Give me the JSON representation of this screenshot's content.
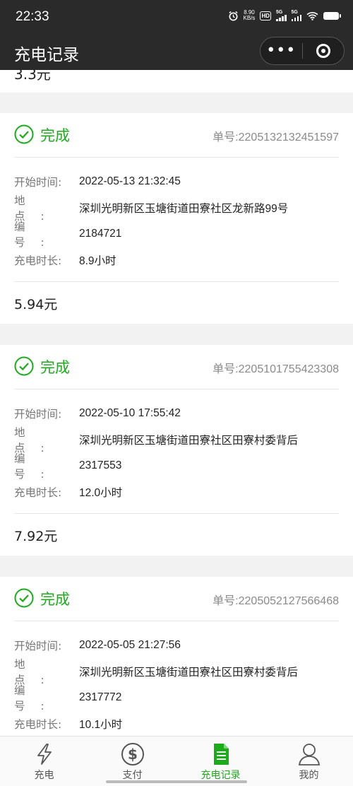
{
  "status_bar": {
    "time": "22:33",
    "net_speed_value": "8.90",
    "net_speed_unit": "KB/s",
    "hd_label": "HD",
    "signal1_label": "5G",
    "signal2_label": "5G"
  },
  "nav": {
    "title": "充电记录",
    "more_icon": "more-dots-icon",
    "close_icon": "target-circle-icon"
  },
  "partial_record": {
    "amount": "3.3元"
  },
  "records": [
    {
      "status": "完成",
      "order_no": "单号:2205132132451597",
      "start_time_label": "开始时间:",
      "start_time": "2022-05-13 21:32:45",
      "location_label": "地点:",
      "location": "深圳光明新区玉塘街道田寮社区龙新路99号",
      "number_label": "编号:",
      "number": "2184721",
      "duration_label": "充电时长:",
      "duration": "8.9小时",
      "amount": "5.94元"
    },
    {
      "status": "完成",
      "order_no": "单号:2205101755423308",
      "start_time_label": "开始时间:",
      "start_time": "2022-05-10 17:55:42",
      "location_label": "地点:",
      "location": "深圳光明新区玉塘街道田寮社区田寮村委背后",
      "number_label": "编号:",
      "number": "2317553",
      "duration_label": "充电时长:",
      "duration": "12.0小时",
      "amount": "7.92元"
    },
    {
      "status": "完成",
      "order_no": "单号:2205052127566468",
      "start_time_label": "开始时间:",
      "start_time": "2022-05-05 21:27:56",
      "location_label": "地点:",
      "location": "深圳光明新区玉塘街道田寮社区田寮村委背后",
      "number_label": "编号:",
      "number": "2317772",
      "duration_label": "充电时长:",
      "duration": "10.1小时",
      "amount": ""
    }
  ],
  "tabs": [
    {
      "label": "充电",
      "icon": "lightning-icon",
      "active": false
    },
    {
      "label": "支付",
      "icon": "dollar-icon",
      "active": false
    },
    {
      "label": "充电记录",
      "icon": "document-list-icon",
      "active": true
    },
    {
      "label": "我的",
      "icon": "user-icon",
      "active": false
    }
  ],
  "colors": {
    "accent": "#1aad19",
    "header_bg": "#2a2a2a",
    "page_bg": "#f2f2f2"
  }
}
